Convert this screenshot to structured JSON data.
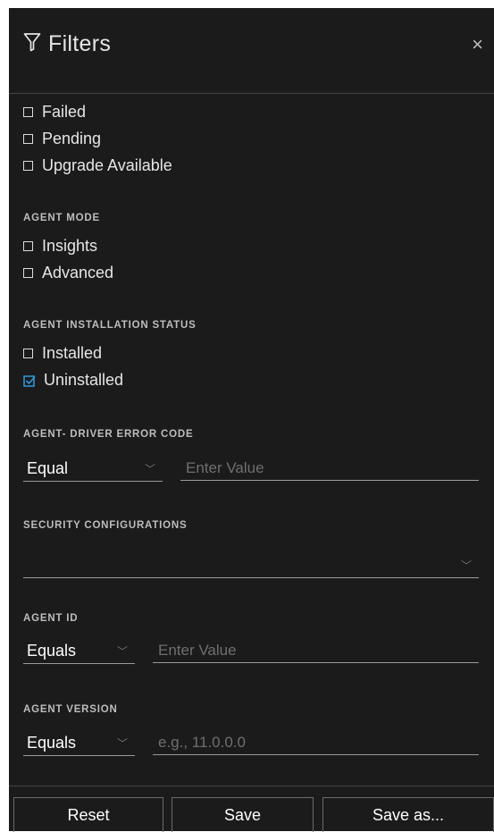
{
  "header": {
    "title": "Filters",
    "close_label": "×"
  },
  "status_items": [
    {
      "label": "Failed",
      "checked": false
    },
    {
      "label": "Pending",
      "checked": false
    },
    {
      "label": "Upgrade Available",
      "checked": false
    }
  ],
  "agent_mode": {
    "heading": "AGENT MODE",
    "items": [
      {
        "label": "Insights",
        "checked": false
      },
      {
        "label": "Advanced",
        "checked": false
      }
    ]
  },
  "install_status": {
    "heading": "AGENT INSTALLATION STATUS",
    "items": [
      {
        "label": "Installed",
        "checked": false
      },
      {
        "label": "Uninstalled",
        "checked": true
      }
    ]
  },
  "driver_error": {
    "heading": "AGENT- DRIVER ERROR CODE",
    "operator": "Equal",
    "placeholder": "Enter Value"
  },
  "security": {
    "heading": "SECURITY CONFIGURATIONS",
    "value": ""
  },
  "agent_id": {
    "heading": "AGENT ID",
    "operator": "Equals",
    "placeholder": "Enter Value"
  },
  "agent_version": {
    "heading": "AGENT VERSION",
    "operator": "Equals",
    "placeholder": "e.g., 11.0.0.0"
  },
  "footer": {
    "reset": "Reset",
    "save": "Save",
    "save_as": "Save as..."
  },
  "colors": {
    "panel_bg": "#1b1b1b",
    "accent": "#2f9be0",
    "text": "#e6e6e6"
  }
}
